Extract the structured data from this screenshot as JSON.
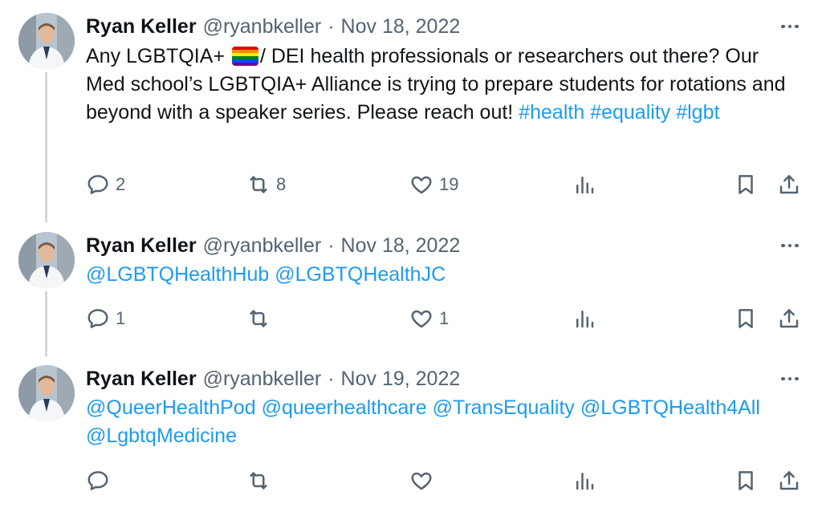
{
  "colors": {
    "link": "#1d9bf0",
    "secondary": "#536471",
    "text": "#0f1419",
    "thread_line": "#cfd9de"
  },
  "tweets": [
    {
      "name": "Ryan Keller",
      "handle": "@ryanbkeller",
      "separator": "·",
      "date": "Nov 18, 2022",
      "text_before_flag": "Any LGBTQIA+ ",
      "flag_icon": "rainbow-flag-emoji",
      "text_after_flag": "/ DEI health professionals or researchers out there? Our Med school’s LGBTQIA+ Alliance is trying to prepare students for rotations and beyond with a speaker series. Please reach out! ",
      "hashtags": [
        "#health",
        "#equality",
        "#lgbt"
      ],
      "replies": "2",
      "retweets": "8",
      "likes": "19"
    },
    {
      "name": "Ryan Keller",
      "handle": "@ryanbkeller",
      "separator": "·",
      "date": "Nov 18, 2022",
      "mentions": [
        "@LGBTQHealthHub",
        "@LGBTQHealthJC"
      ],
      "replies": "1",
      "retweets": "",
      "likes": "1"
    },
    {
      "name": "Ryan Keller",
      "handle": "@ryanbkeller",
      "separator": "·",
      "date": "Nov 19, 2022",
      "mentions": [
        "@QueerHealthPod",
        "@queerhealthcare",
        "@TransEquality",
        "@LGBTQHealth4All",
        "@LgbtqMedicine"
      ],
      "replies": "",
      "retweets": "",
      "likes": ""
    }
  ],
  "icons": [
    "reply-icon",
    "retweet-icon",
    "like-icon",
    "views-icon",
    "bookmark-icon",
    "share-icon",
    "more-icon"
  ]
}
